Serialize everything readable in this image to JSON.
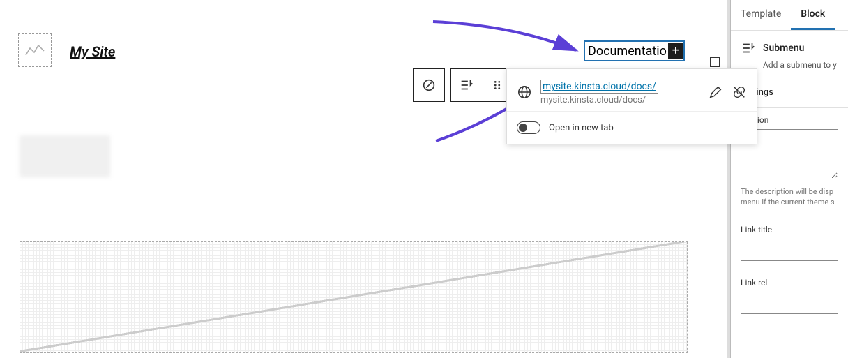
{
  "site_title": "My Site",
  "nav": {
    "label": "Documentatio",
    "add": "+"
  },
  "toolbar": {
    "icons": [
      "block-icon",
      "submenu-icon",
      "drag-icon"
    ]
  },
  "link_popover": {
    "url": "mysite.kinsta.cloud/docs/",
    "url_sub": "mysite.kinsta.cloud/docs/",
    "open_new_tab": "Open in new tab"
  },
  "sidebar": {
    "tabs": {
      "template": "Template",
      "block": "Block"
    },
    "block": {
      "name": "Submenu",
      "desc": "Add a submenu to y"
    },
    "panel_label": "settings",
    "desc_label": "cription",
    "desc_help": "The description will be disp\nmenu if the current theme s",
    "link_title_label": "Link title",
    "link_rel_label": "Link rel"
  },
  "colors": {
    "accent": "#2271b1",
    "arrow": "#5b3fd6"
  }
}
